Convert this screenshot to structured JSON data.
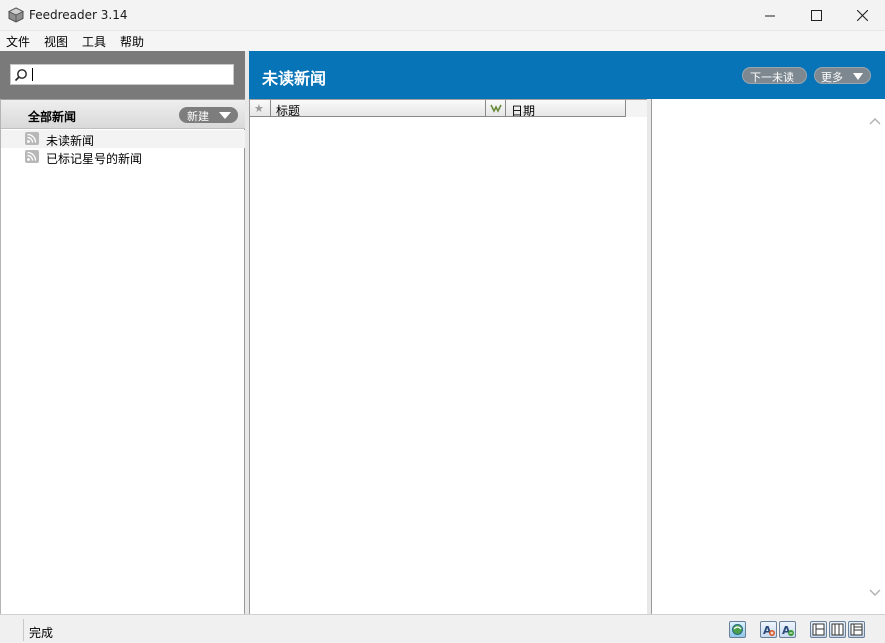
{
  "window": {
    "title": "Feedreader 3.14"
  },
  "menu": {
    "items": [
      "文件",
      "视图",
      "工具",
      "帮助"
    ]
  },
  "search": {
    "value": "",
    "placeholder": ""
  },
  "sidebar": {
    "all_news_label": "全部新闻",
    "new_button_label": "新建",
    "feeds": [
      {
        "label": "未读新闻",
        "icon": "rss-icon"
      },
      {
        "label": "已标记星号的新闻",
        "icon": "rss-icon"
      }
    ]
  },
  "header": {
    "title": "未读新闻",
    "next_unread_label": "下一未读",
    "more_label": "更多",
    "accent_color": "#0874b8"
  },
  "list": {
    "columns": [
      {
        "label": "",
        "icon": "star-icon"
      },
      {
        "label": "标题"
      },
      {
        "label": "",
        "icon": "date-sort-icon"
      },
      {
        "label": "日期"
      }
    ],
    "rows": []
  },
  "status": {
    "text": "完成",
    "icons": [
      "sync-icon",
      "font-larger-icon",
      "font-smaller-icon",
      "layout-1-icon",
      "layout-2-icon",
      "layout-3-icon"
    ]
  }
}
